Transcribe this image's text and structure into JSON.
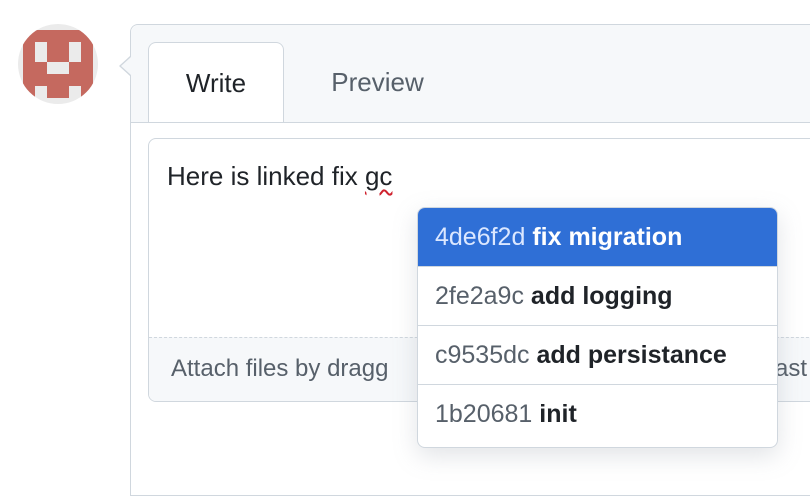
{
  "avatar": {
    "icon": "identicon",
    "colors": {
      "fill": "#c5695f",
      "bg": "#ebebeb"
    }
  },
  "tabs": {
    "write_label": "Write",
    "preview_label": "Preview"
  },
  "editor": {
    "text_before": "Here is linked fix ",
    "text_typo": "gc",
    "footer_text_left": "Attach files by dragg",
    "footer_text_right": "ast"
  },
  "suggestions": [
    {
      "sha": "4de6f2d",
      "message": "fix migration",
      "active": true
    },
    {
      "sha": "2fe2a9c",
      "message": "add logging",
      "active": false
    },
    {
      "sha": "c9535dc",
      "message": "add persistance",
      "active": false
    },
    {
      "sha": "1b20681",
      "message": "init",
      "active": false
    }
  ],
  "colors": {
    "accent": "#2f6fd6",
    "border": "#d0d7de",
    "muted": "#57606a"
  }
}
